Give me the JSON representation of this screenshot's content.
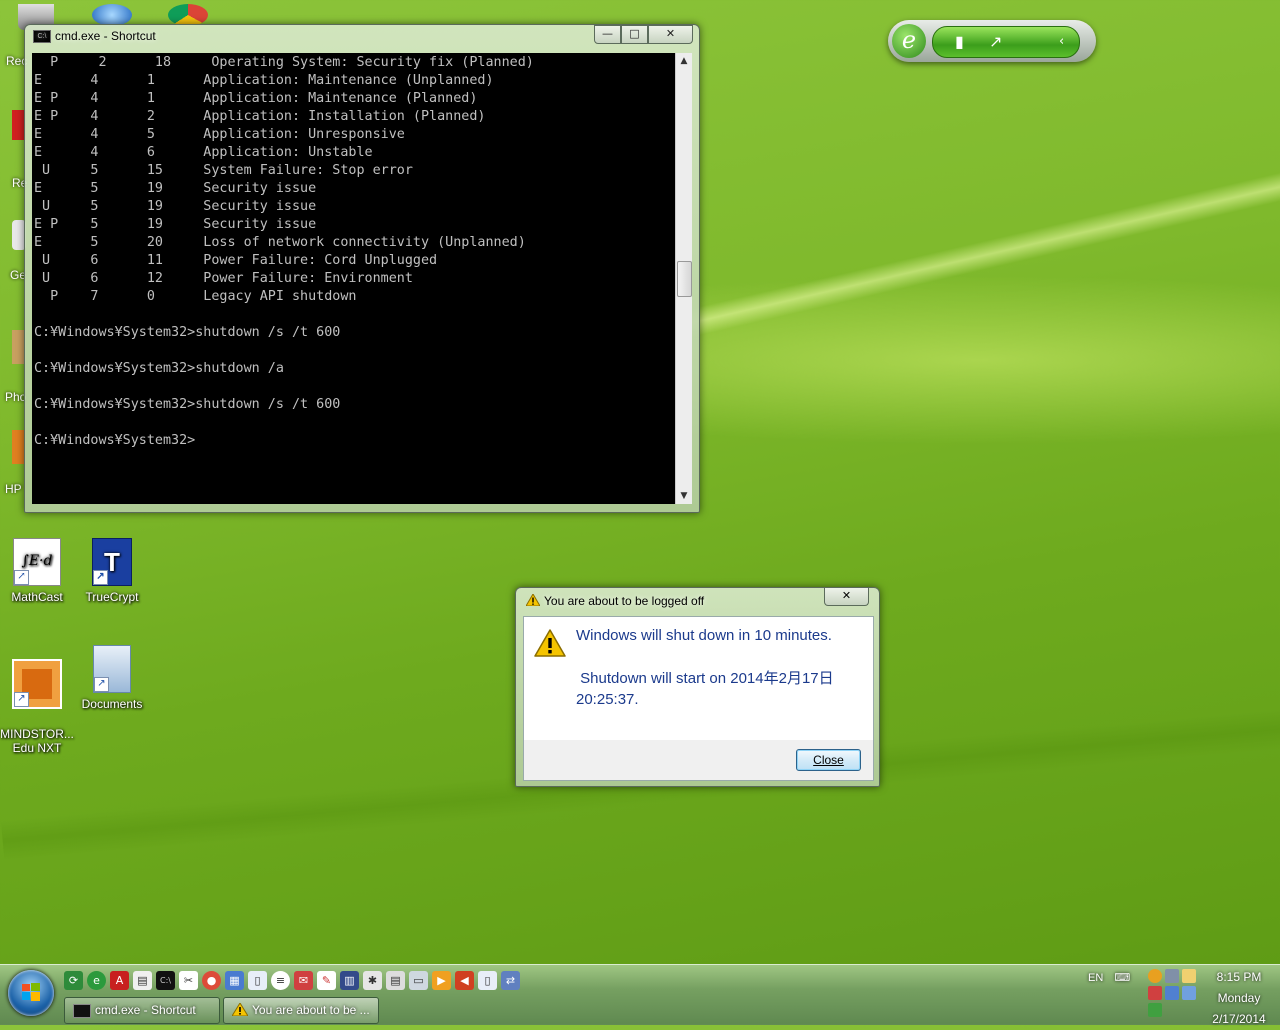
{
  "desktop": {
    "icons": [
      {
        "label": "MathCast"
      },
      {
        "label": "TrueCrypt"
      },
      {
        "label": "MINDSTOR...\nEdu NXT"
      },
      {
        "label": "Documents"
      }
    ],
    "edge_labels": [
      "Rec",
      "Re",
      "Ge",
      "Pho",
      "HP"
    ]
  },
  "cmd_window": {
    "title": "cmd.exe - Shortcut",
    "console_lines": [
      "  P     2      18     Operating System: Security fix (Planned)",
      "E      4      1      Application: Maintenance (Unplanned)",
      "E P    4      1      Application: Maintenance (Planned)",
      "E P    4      2      Application: Installation (Planned)",
      "E      4      5      Application: Unresponsive",
      "E      4      6      Application: Unstable",
      " U     5      15     System Failure: Stop error",
      "E      5      19     Security issue",
      " U     5      19     Security issue",
      "E P    5      19     Security issue",
      "E      5      20     Loss of network connectivity (Unplanned)",
      " U     6      11     Power Failure: Cord Unplugged",
      " U     6      12     Power Failure: Environment",
      "  P    7      0      Legacy API shutdown",
      "",
      "C:¥Windows¥System32>shutdown /s /t 600",
      "",
      "C:¥Windows¥System32>shutdown /a",
      "",
      "C:¥Windows¥System32>shutdown /s /t 600",
      "",
      "C:¥Windows¥System32>"
    ]
  },
  "dialog": {
    "title": "You are about to be logged off",
    "message1": "Windows will shut down in 10 minutes.",
    "message2": " Shutdown will start on 2014年2月17日 20:25:37.",
    "close_label": "Close"
  },
  "taskbar": {
    "buttons": [
      {
        "label": "cmd.exe - Shortcut"
      },
      {
        "label": "You are about to be ..."
      }
    ],
    "language": "EN",
    "clock": {
      "time": "8:15 PM",
      "day": "Monday",
      "date": "2/17/2014"
    }
  },
  "colors": {
    "console_bg": "#000000",
    "console_text": "#c0c0c0",
    "dialog_text": "#1b3a8c",
    "warning_yellow": "#f5c400"
  }
}
